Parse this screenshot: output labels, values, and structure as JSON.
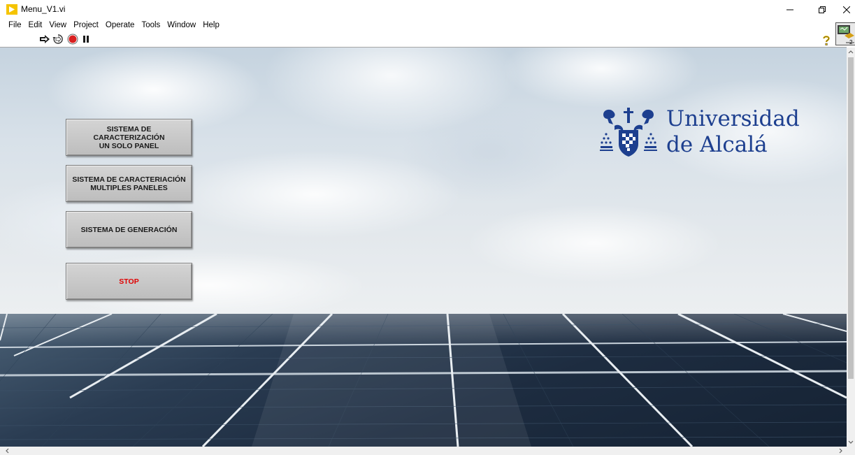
{
  "window": {
    "title": "Menu_V1.vi",
    "minimize_glyph": "–",
    "restore_glyph": "❐",
    "close_glyph": "✕"
  },
  "menubar": {
    "items": [
      "File",
      "Edit",
      "View",
      "Project",
      "Operate",
      "Tools",
      "Window",
      "Help"
    ]
  },
  "toolbar": {
    "icons": [
      "run-arrow-icon",
      "run-continuously-icon",
      "abort-execution-icon",
      "pause-icon",
      "context-help-icon",
      "connector-pane-icon"
    ]
  },
  "front_panel": {
    "buttons": [
      {
        "label": "SISTEMA DE CARACTERIZACIÓN\nUN SOLO PANEL"
      },
      {
        "label": "SISTEMA DE CARACTERIACIÓN\nMULTIPLES PANELES"
      },
      {
        "label": "SISTEMA DE GENERACIÓN"
      },
      {
        "label": "STOP"
      }
    ],
    "stop_color": "#e00000",
    "logo": {
      "name": "Universidad\nde Alcalá",
      "color": "#1d3f8f"
    }
  },
  "colors": {
    "button_face": "#c8c8c8",
    "panel_dark": "#1d2c40"
  }
}
